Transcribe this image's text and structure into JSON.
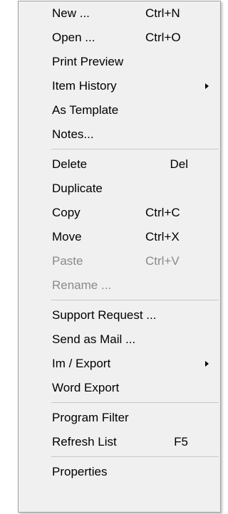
{
  "menu": {
    "items": [
      {
        "label": "New ...",
        "shortcut": "Ctrl+N",
        "enabled": true
      },
      {
        "label": "Open ...",
        "shortcut": "Ctrl+O",
        "enabled": true
      },
      {
        "label": "Print Preview",
        "shortcut": "",
        "enabled": true
      },
      {
        "label": "Item History",
        "shortcut": "",
        "enabled": true,
        "submenu": true
      },
      {
        "label": "As Template",
        "shortcut": "",
        "enabled": true
      },
      {
        "label": "Notes...",
        "shortcut": "",
        "enabled": true
      },
      {
        "label": "Delete",
        "shortcut": "Del",
        "enabled": true
      },
      {
        "label": "Duplicate",
        "shortcut": "",
        "enabled": true
      },
      {
        "label": "Copy",
        "shortcut": "Ctrl+C",
        "enabled": true
      },
      {
        "label": "Move",
        "shortcut": "Ctrl+X",
        "enabled": true
      },
      {
        "label": "Paste",
        "shortcut": "Ctrl+V",
        "enabled": false
      },
      {
        "label": "Rename ...",
        "shortcut": "",
        "enabled": false
      },
      {
        "label": "Support Request ...",
        "shortcut": "",
        "enabled": true
      },
      {
        "label": "Send as Mail ...",
        "shortcut": "",
        "enabled": true
      },
      {
        "label": "Im / Export",
        "shortcut": "",
        "enabled": true,
        "submenu": true
      },
      {
        "label": "Word Export",
        "shortcut": "",
        "enabled": true
      },
      {
        "label": "Program Filter",
        "shortcut": "",
        "enabled": true
      },
      {
        "label": "Refresh List",
        "shortcut": "F5",
        "enabled": true
      },
      {
        "label": "Properties",
        "shortcut": "",
        "enabled": true
      }
    ]
  },
  "colors": {
    "menu_background": "#f0f0f0",
    "menu_border": "#a0a0a0",
    "separator": "#c8c8c8",
    "text": "#000000",
    "disabled_text": "#8a8a8a"
  }
}
